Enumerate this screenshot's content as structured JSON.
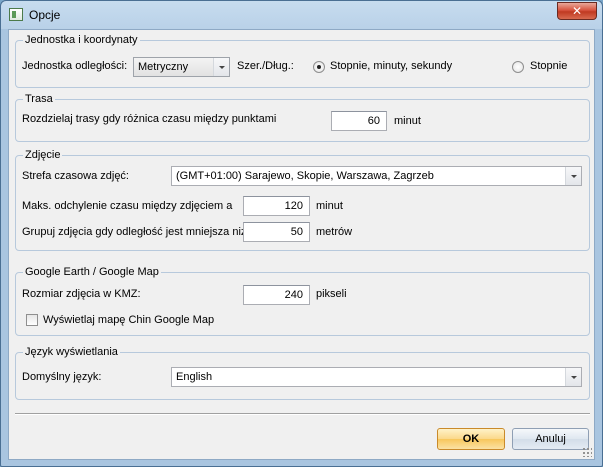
{
  "window": {
    "title": "Opcje",
    "close_label": "✕"
  },
  "units": {
    "group_title": "Jednostka i koordynaty",
    "distance_label": "Jednostka odległości:",
    "distance_value": "Metryczny",
    "latlon_label": "Szer./Dług.:",
    "radio_dms_label": "Stopnie, minuty, sekundy",
    "radio_deg_label": "Stopnie",
    "selected": "Stopnie, minuty, sekundy"
  },
  "route": {
    "group_title": "Trasa",
    "split_label": "Rozdzielaj trasy gdy różnica czasu między punktami",
    "split_value": "60",
    "split_unit": "minut"
  },
  "photo": {
    "group_title": "Zdjęcie",
    "tz_label": "Strefa czasowa zdjęć:",
    "tz_value": "(GMT+01:00) Sarajewo, Skopie, Warszawa, Zagrzeb",
    "deviation_label": "Maks. odchylenie czasu między zdjęciem a",
    "deviation_value": "120",
    "deviation_unit": "minut",
    "group_label": "Grupuj zdjęcia gdy odległość jest mniejsza niż",
    "group_value": "50",
    "group_unit": "metrów"
  },
  "google": {
    "group_title": "Google Earth / Google Map",
    "kmz_label": "Rozmiar zdjęcia w KMZ:",
    "kmz_value": "240",
    "kmz_unit": "pikseli",
    "china_label": "Wyświetlaj mapę Chin Google Map",
    "china_checked": false
  },
  "language": {
    "group_title": "Język wyświetlania",
    "default_label": "Domyślny język:",
    "default_value": "English"
  },
  "buttons": {
    "ok_label": "OK",
    "cancel_label": "Anuluj"
  },
  "icons": {
    "app": "options-window-icon",
    "close": "close-icon",
    "dropdown": "chevron-down-icon"
  }
}
